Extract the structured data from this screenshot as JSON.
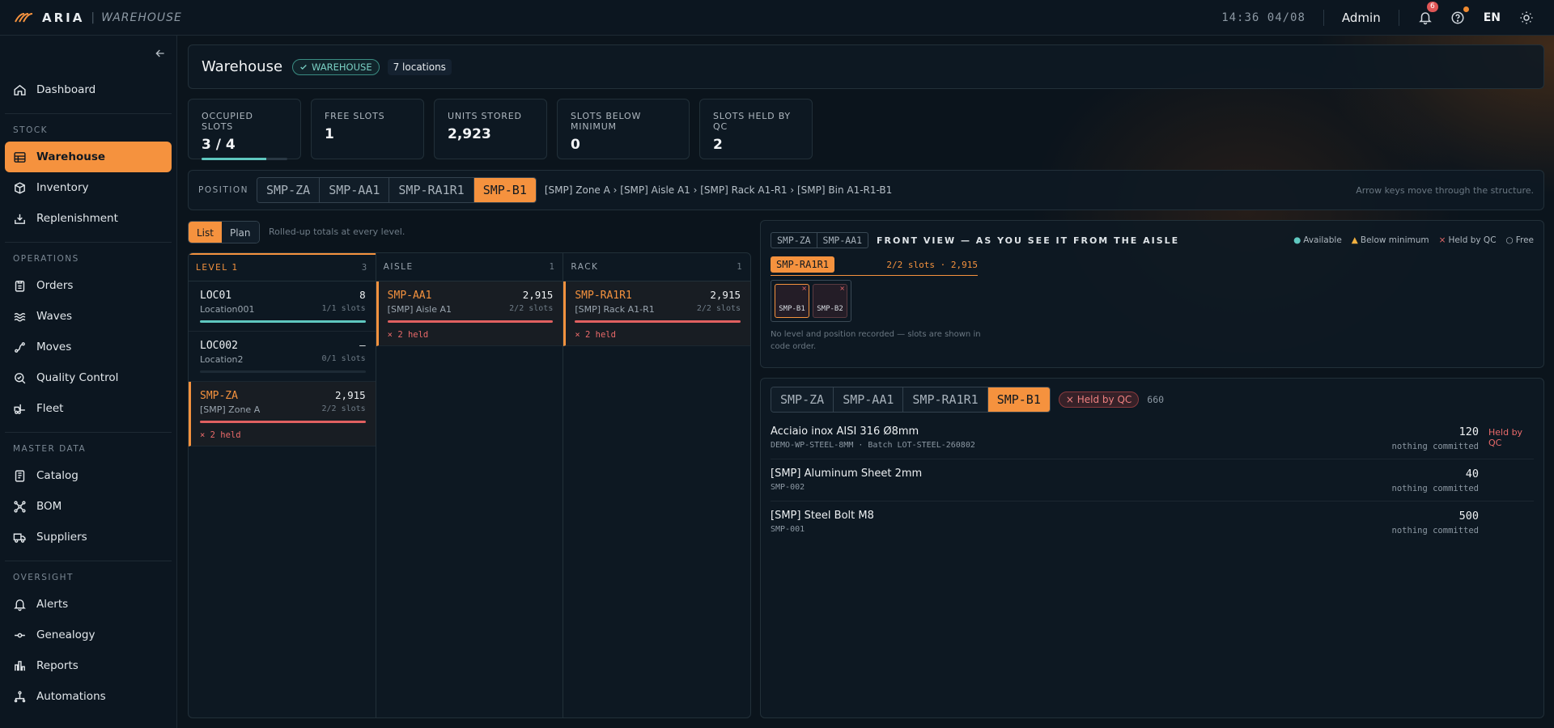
{
  "app": {
    "brand": "ARIA",
    "module": "WAREHOUSE",
    "clock": "14:36 04/08",
    "user": "Admin",
    "notifications": "6",
    "lang": "EN"
  },
  "nav": {
    "top": [
      {
        "label": "Dashboard",
        "icon": "home-icon"
      }
    ],
    "sections": [
      {
        "title": "STOCK",
        "items": [
          "Warehouse",
          "Inventory",
          "Replenishment"
        ]
      },
      {
        "title": "OPERATIONS",
        "items": [
          "Orders",
          "Waves",
          "Moves",
          "Quality Control",
          "Fleet"
        ]
      },
      {
        "title": "MASTER DATA",
        "items": [
          "Catalog",
          "BOM",
          "Suppliers"
        ]
      },
      {
        "title": "OVERSIGHT",
        "items": [
          "Alerts",
          "Genealogy",
          "Reports",
          "Automations"
        ]
      }
    ],
    "active": "Warehouse"
  },
  "header": {
    "title": "Warehouse",
    "tag": "WAREHOUSE",
    "locations": "7 locations"
  },
  "kpis": [
    {
      "label": "OCCUPIED SLOTS",
      "value": "3 / 4",
      "progress": 0.75
    },
    {
      "label": "FREE SLOTS",
      "value": "1"
    },
    {
      "label": "UNITS STORED",
      "value": "2,923"
    },
    {
      "label": "SLOTS BELOW MINIMUM",
      "value": "0"
    },
    {
      "label": "SLOTS HELD BY QC",
      "value": "2"
    }
  ],
  "position": {
    "label": "POSITION",
    "segments": [
      "SMP-ZA",
      "SMP-AA1",
      "SMP-RA1R1",
      "SMP-B1"
    ],
    "breadcrumb": "[SMP] Zone A › [SMP] Aisle A1 › [SMP] Rack A1-R1 › [SMP] Bin A1-R1-B1",
    "hint": "Arrow keys move through the structure."
  },
  "view_toggle": {
    "list": "List",
    "plan": "Plan",
    "note": "Rolled-up totals at every level."
  },
  "columns": [
    {
      "title": "LEVEL 1",
      "count": "3",
      "entries": [
        {
          "code": "LOC01",
          "name": "Location001",
          "units": "8",
          "slots": "1/1 slots",
          "fill": 1.0,
          "color": "#5fc8c0"
        },
        {
          "code": "LOC002",
          "name": "Location2",
          "units": "—",
          "slots": "0/1 slots",
          "fill": 0,
          "color": "#5fc8c0"
        },
        {
          "code": "SMP-ZA",
          "name": "[SMP] Zone A",
          "units": "2,915",
          "slots": "2/2 slots",
          "fill": 1.0,
          "color": "#e06060",
          "held": "× 2 held",
          "selected": true
        }
      ]
    },
    {
      "title": "AISLE",
      "count": "1",
      "entries": [
        {
          "code": "SMP-AA1",
          "name": "[SMP] Aisle A1",
          "units": "2,915",
          "slots": "2/2 slots",
          "fill": 1.0,
          "color": "#e06060",
          "held": "× 2 held",
          "selected": true
        }
      ]
    },
    {
      "title": "RACK",
      "count": "1",
      "entries": [
        {
          "code": "SMP-RA1R1",
          "name": "[SMP] Rack A1-R1",
          "units": "2,915",
          "slots": "2/2 slots",
          "fill": 1.0,
          "color": "#e06060",
          "held": "× 2 held",
          "selected": true
        }
      ]
    }
  ],
  "front_view": {
    "crumbs": [
      "SMP-ZA",
      "SMP-AA1"
    ],
    "title": "FRONT VIEW — AS YOU SEE IT FROM THE AISLE",
    "legend": [
      {
        "mark": "●",
        "label": "Available",
        "color": "#5fc8c0"
      },
      {
        "mark": "▲",
        "label": "Below minimum",
        "color": "#f0b040"
      },
      {
        "mark": "×",
        "label": "Held by QC",
        "color": "#ea6a6a"
      },
      {
        "mark": "○",
        "label": "Free",
        "color": "#aeb7bf"
      }
    ],
    "rack": "SMP-RA1R1",
    "rack_info": "2/2 slots · 2,915",
    "bins": [
      {
        "label": "SMP-B1",
        "mark": "×"
      },
      {
        "label": "SMP-B2",
        "mark": "×"
      }
    ],
    "note": "No level and position recorded — slots are shown in code order."
  },
  "detail": {
    "segments": [
      "SMP-ZA",
      "SMP-AA1",
      "SMP-RA1R1",
      "SMP-B1"
    ],
    "held_chip": "× Held by QC",
    "qty": "660",
    "items": [
      {
        "name": "Acciaio inox AISI 316 Ø8mm",
        "sub": "DEMO-WP-STEEL-8MM · Batch LOT-STEEL-260802",
        "qty": "120",
        "committed": "nothing committed",
        "status": "Held by QC"
      },
      {
        "name": "[SMP] Aluminum Sheet 2mm",
        "sub": "SMP-002",
        "qty": "40",
        "committed": "nothing committed",
        "status": ""
      },
      {
        "name": "[SMP] Steel Bolt M8",
        "sub": "SMP-001",
        "qty": "500",
        "committed": "nothing committed",
        "status": ""
      }
    ]
  }
}
